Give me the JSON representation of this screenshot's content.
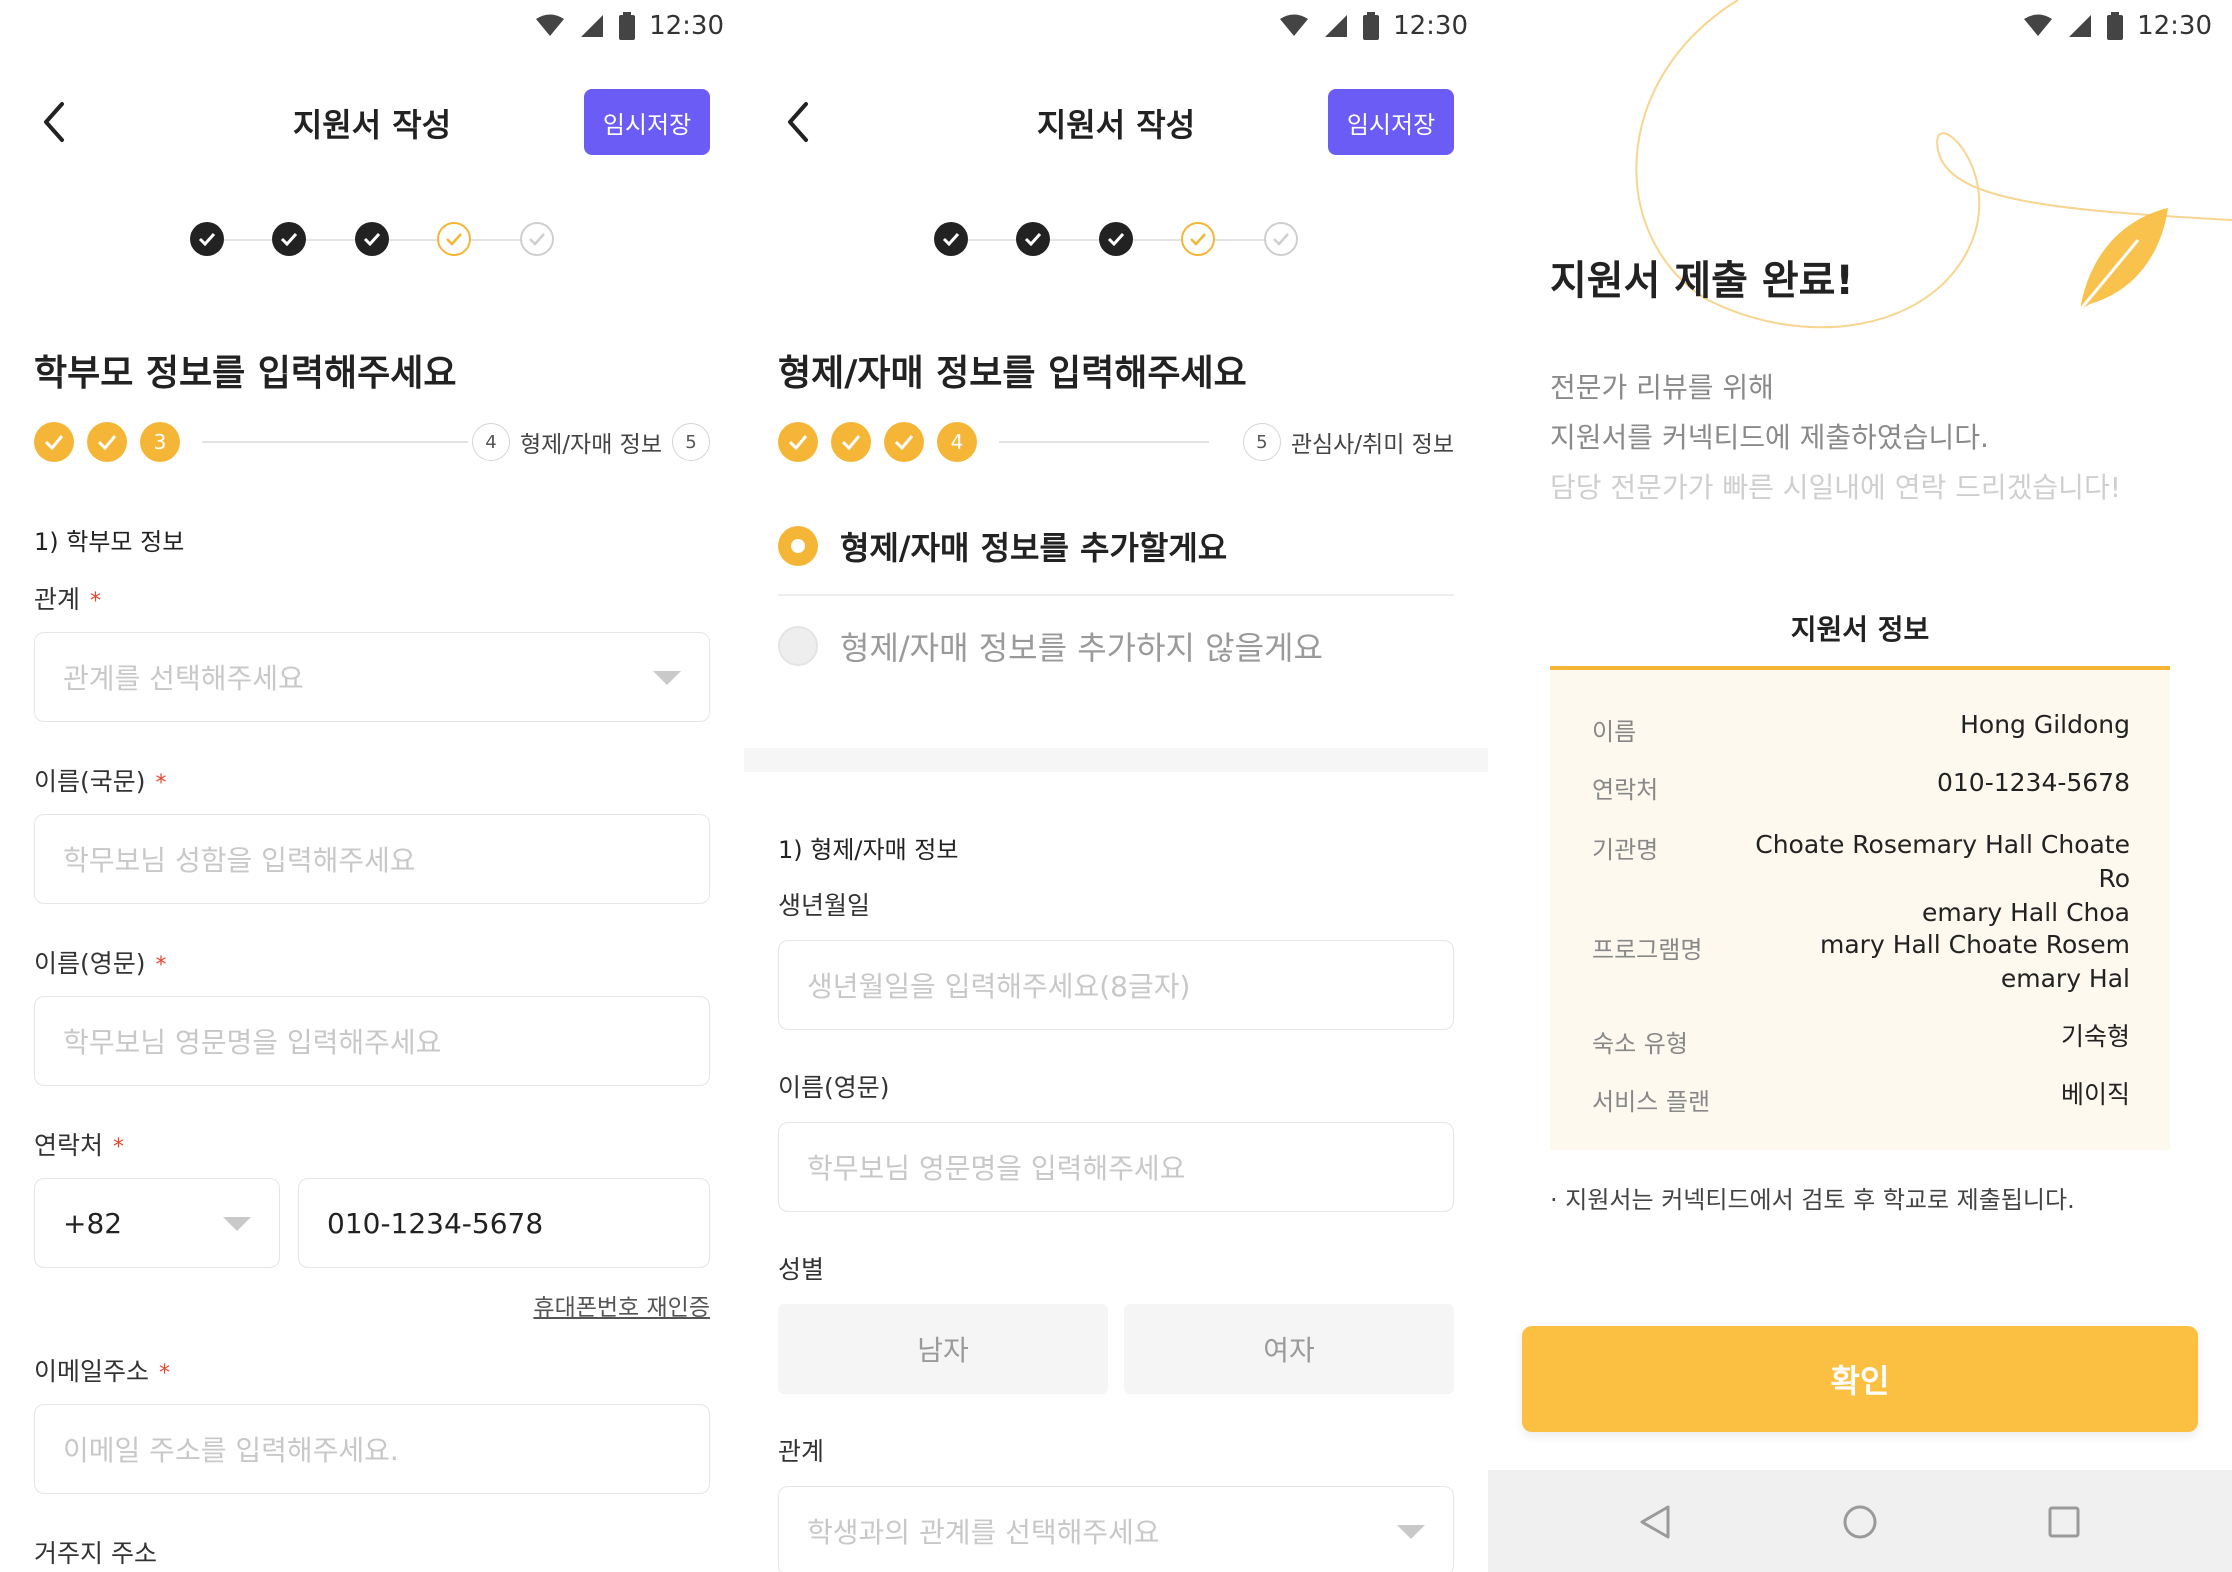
{
  "status": {
    "time": "12:30"
  },
  "screens": [
    {
      "header": {
        "title": "지원서 작성",
        "save_label": "임시저장"
      },
      "heading": "학부모 정보를 입력해주세요",
      "subprogress": {
        "current_number": "3",
        "next_number": "4",
        "next_label": "형제/자매 정보",
        "last_number": "5"
      },
      "section_label": "1) 학부모 정보",
      "fields": {
        "relation_label": "관계",
        "relation_placeholder": "관계를 선택해주세요",
        "name_kr_label": "이름(국문)",
        "name_kr_placeholder": "학무보님 성함을 입력해주세요",
        "name_en_label": "이름(영문)",
        "name_en_placeholder": "학무보님 영문명을 입력해주세요",
        "phone_label": "연락처",
        "country_code": "+82",
        "phone_value": "010-1234-5678",
        "reverify_link": "휴대폰번호 재인증",
        "email_label": "이메일주소",
        "email_placeholder": "이메일 주소를 입력해주세요.",
        "address_label": "거주지 주소",
        "required_mark": "*"
      }
    },
    {
      "header": {
        "title": "지원서 작성",
        "save_label": "임시저장"
      },
      "heading": "형제/자매 정보를 입력해주세요",
      "subprogress": {
        "current_number": "4",
        "next_number": "5",
        "next_label": "관심사/취미 정보"
      },
      "options": {
        "add": "형제/자매 정보를 추가할게요",
        "skip": "형제/자매 정보를 추가하지 않을게요"
      },
      "section_label": "1) 형제/자매 정보",
      "fields": {
        "birth_label": "생년월일",
        "birth_placeholder": "생년월일을 입력해주세요(8글자)",
        "name_en_label": "이름(영문)",
        "name_en_placeholder": "학무보님 영문명을 입력해주세요",
        "gender_label": "성별",
        "gender_male": "남자",
        "gender_female": "여자",
        "relation_label": "관계",
        "relation_placeholder": "학생과의 관계를 선택해주세요"
      }
    },
    {
      "title": "지원서 제출 완료!",
      "desc_lines": [
        "전문가 리뷰를 위해",
        "지원서를 커넥티드에 제출하였습니다.",
        "담당 전문가가 빠른 시일내에 연락 드리겠습니다!"
      ],
      "info_title": "지원서 정보",
      "info": {
        "name_key": "이름",
        "name_val": "Hong Gildong",
        "contact_key": "연락처",
        "contact_val": "010-1234-5678",
        "org_key": "기관명",
        "org_val_1": "Choate Rosemary Hall Choate Ro",
        "org_val_2": "emary Hall Choa",
        "program_key": "프로그램명",
        "program_val_1": "mary Hall Choate Rosem",
        "program_val_2": "emary Hal",
        "housing_key": "숙소 유형",
        "housing_val": "기숙형",
        "plan_key": "서비스 플랜",
        "plan_val": "베이직"
      },
      "note": "· 지원서는 커넥티드에서 검토 후 학교로 제출됩니다.",
      "confirm_label": "확인"
    }
  ],
  "colors": {
    "accent": "#f5b638",
    "save_button": "#6b5cf6",
    "confirm": "#fbc042",
    "required": "#e8452e"
  },
  "icons": [
    "wifi-icon",
    "signal-icon",
    "battery-icon",
    "back-arrow-icon",
    "check-icon",
    "feather-icon",
    "nav-back-icon",
    "nav-home-icon",
    "nav-recent-icon"
  ]
}
